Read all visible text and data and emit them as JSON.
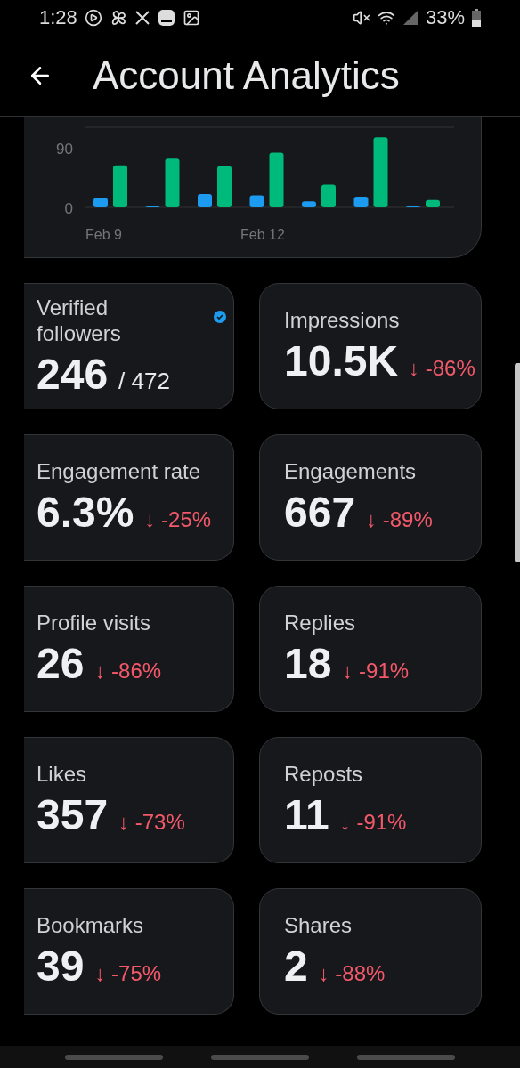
{
  "status_bar": {
    "time": "1:28",
    "battery": "33%"
  },
  "header": {
    "title": "Account Analytics"
  },
  "chart_card": {
    "chart_data": {
      "type": "bar",
      "categories": [
        "Feb 9",
        null,
        null,
        "Feb 12",
        null,
        null,
        null
      ],
      "stacked": false,
      "ylim": [
        0,
        120
      ],
      "yticks": [
        0,
        90
      ],
      "series": [
        {
          "color": "#1d9bf0",
          "values": [
            14,
            2,
            20,
            18,
            9,
            16,
            2
          ]
        },
        {
          "color": "#00ba7c",
          "values": [
            63,
            73,
            62,
            82,
            34,
            105,
            11
          ]
        }
      ]
    }
  },
  "metrics": [
    {
      "label": "Verified followers",
      "value": "246",
      "total": "/ 472",
      "verified": true
    },
    {
      "label": "Impressions",
      "value": "10.5K",
      "change": "↓ -86%"
    },
    {
      "label": "Engagement rate",
      "value": "6.3%",
      "change": "↓ -25%"
    },
    {
      "label": "Engagements",
      "value": "667",
      "change": "↓ -89%"
    },
    {
      "label": "Profile visits",
      "value": "26",
      "change": "↓ -86%"
    },
    {
      "label": "Replies",
      "value": "18",
      "change": "↓ -91%"
    },
    {
      "label": "Likes",
      "value": "357",
      "change": "↓ -73%"
    },
    {
      "label": "Reposts",
      "value": "11",
      "change": "↓ -91%"
    },
    {
      "label": "Bookmarks",
      "value": "39",
      "change": "↓ -75%"
    },
    {
      "label": "Shares",
      "value": "2",
      "change": "↓ -88%"
    }
  ]
}
